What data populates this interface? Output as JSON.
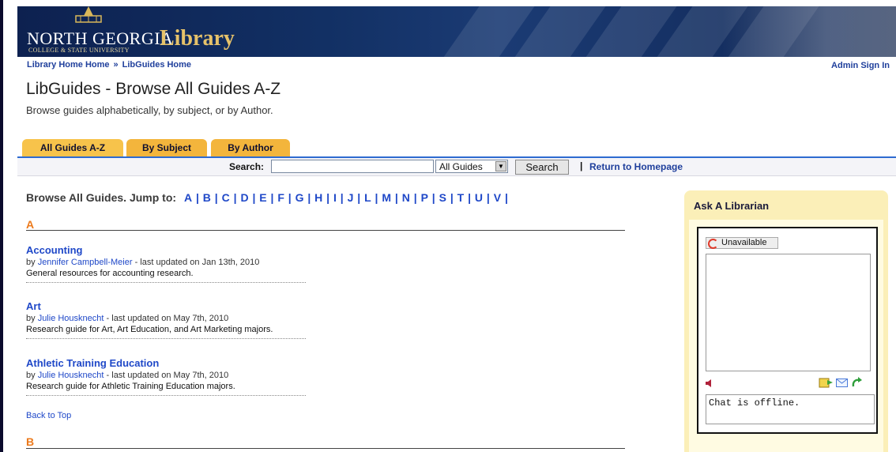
{
  "banner": {
    "logo_line1": "NORTH GEORGIA",
    "logo_line2": "COLLEGE & STATE UNIVERSITY",
    "logo_library": "Library"
  },
  "breadcrumb": {
    "item1": "Library Home Home",
    "separator": "»",
    "item2": "LibGuides Home"
  },
  "admin_link": "Admin Sign In",
  "page": {
    "title": "LibGuides - Browse All Guides A-Z",
    "subtitle": "Browse guides alphabetically, by subject, or by Author."
  },
  "tabs": [
    {
      "label": "All Guides A-Z",
      "active": true
    },
    {
      "label": "By Subject",
      "active": false
    },
    {
      "label": "By Author",
      "active": false
    }
  ],
  "search": {
    "label": "Search:",
    "value": "",
    "scope": "All Guides",
    "button": "Search",
    "separator": "|",
    "return_link": "Return to Homepage"
  },
  "browse": {
    "heading": "Browse All Guides. Jump to:",
    "letters": [
      "A",
      "B",
      "C",
      "D",
      "E",
      "F",
      "G",
      "H",
      "I",
      "J",
      "L",
      "M",
      "N",
      "P",
      "S",
      "T",
      "U",
      "V"
    ]
  },
  "sections": [
    {
      "letter": "A",
      "guides": [
        {
          "title": "Accounting",
          "by": "by",
          "author": "Jennifer Campbell-Meier",
          "updated": " - last updated on Jan 13th, 2010",
          "desc": "General resources for accounting research."
        },
        {
          "title": "Art",
          "by": "by",
          "author": "Julie Housknecht",
          "updated": " - last updated on May 7th, 2010",
          "desc": "Research guide for Art, Art Education, and Art Marketing majors."
        },
        {
          "title": "Athletic Training Education",
          "by": "by",
          "author": "Julie Housknecht",
          "updated": " - last updated on May 7th, 2010",
          "desc": "Research guide for Athletic Training Education majors."
        }
      ]
    },
    {
      "letter": "B",
      "guides": []
    }
  ],
  "back_to_top": "Back to Top",
  "ask": {
    "title": "Ask A Librarian",
    "status": "Unavailable",
    "offline_text": "Chat is offline."
  },
  "colors": {
    "link": "#1f48c8",
    "tab": "#f3b53c",
    "section_letter": "#ec7a1c",
    "banner": "#123064"
  }
}
